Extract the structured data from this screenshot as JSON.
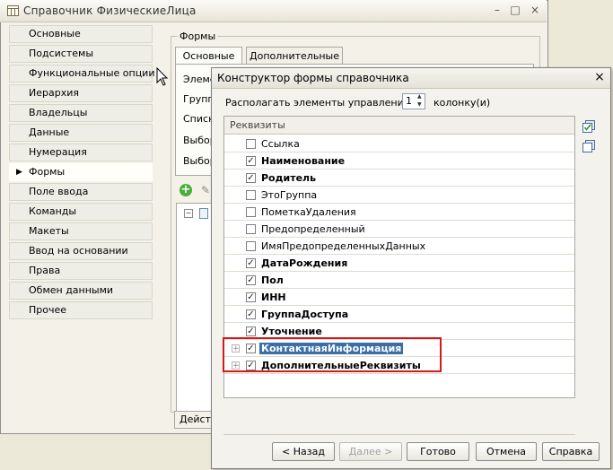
{
  "bg_window": {
    "title": "Справочник ФизическиеЛица",
    "controls": {
      "minimize": "–",
      "maximize": "□",
      "close": "×"
    },
    "left_items": [
      {
        "label": "Основные",
        "selected": false
      },
      {
        "label": "Подсистемы",
        "selected": false
      },
      {
        "label": "Функциональные опции",
        "selected": false
      },
      {
        "label": "Иерархия",
        "selected": false
      },
      {
        "label": "Владельцы",
        "selected": false
      },
      {
        "label": "Данные",
        "selected": false
      },
      {
        "label": "Нумерация",
        "selected": false
      },
      {
        "label": "Формы",
        "selected": true
      },
      {
        "label": "Поле ввода",
        "selected": false
      },
      {
        "label": "Команды",
        "selected": false
      },
      {
        "label": "Макеты",
        "selected": false
      },
      {
        "label": "Ввод на основании",
        "selected": false
      },
      {
        "label": "Права",
        "selected": false
      },
      {
        "label": "Обмен данными",
        "selected": false
      },
      {
        "label": "Прочее",
        "selected": false
      }
    ],
    "forms_group_label": "Формы",
    "tabs": [
      "Основные",
      "Дополнительные"
    ],
    "partial_rows": [
      "Элеме",
      "Групп",
      "Списк",
      "Выбор",
      "Выбор"
    ],
    "actions_button": "Дейст"
  },
  "dialog": {
    "title": "Конструктор формы справочника",
    "close_glyph": "×",
    "columns_label": "Располагать элементы управления в",
    "columns_value": "1",
    "columns_suffix": "колонку(и)",
    "table_header": "Реквизиты",
    "rows": [
      {
        "label": "Ссылка",
        "checked": false,
        "bold": false,
        "expandable": false,
        "selected": false
      },
      {
        "label": "Наименование",
        "checked": true,
        "bold": true,
        "expandable": false,
        "selected": false
      },
      {
        "label": "Родитель",
        "checked": true,
        "bold": true,
        "expandable": false,
        "selected": false
      },
      {
        "label": "ЭтоГруппа",
        "checked": false,
        "bold": false,
        "expandable": false,
        "selected": false
      },
      {
        "label": "ПометкаУдаления",
        "checked": false,
        "bold": false,
        "expandable": false,
        "selected": false
      },
      {
        "label": "Предопределенный",
        "checked": false,
        "bold": false,
        "expandable": false,
        "selected": false
      },
      {
        "label": "ИмяПредопределенныхДанных",
        "checked": false,
        "bold": false,
        "expandable": false,
        "selected": false
      },
      {
        "label": "ДатаРождения",
        "checked": true,
        "bold": true,
        "expandable": false,
        "selected": false
      },
      {
        "label": "Пол",
        "checked": true,
        "bold": true,
        "expandable": false,
        "selected": false
      },
      {
        "label": "ИНН",
        "checked": true,
        "bold": true,
        "expandable": false,
        "selected": false
      },
      {
        "label": "ГруппаДоступа",
        "checked": true,
        "bold": true,
        "expandable": false,
        "selected": false
      },
      {
        "label": "Уточнение",
        "checked": true,
        "bold": true,
        "expandable": false,
        "selected": false
      },
      {
        "label": "КонтактнаяИнформация",
        "checked": true,
        "bold": true,
        "expandable": true,
        "selected": true
      },
      {
        "label": "ДополнительныеРеквизиты",
        "checked": true,
        "bold": true,
        "expandable": true,
        "selected": false
      }
    ],
    "highlight_color": "#d11a1a",
    "buttons": {
      "back": "< Назад",
      "next": "Далее >",
      "done": "Готово",
      "cancel": "Отмена",
      "help": "Справка"
    }
  }
}
